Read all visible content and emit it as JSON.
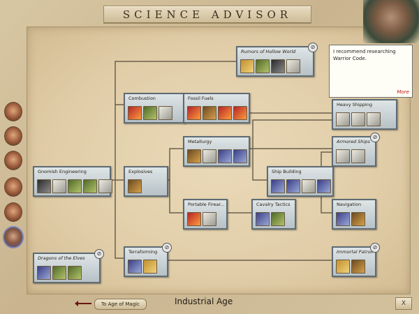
{
  "window": {
    "title": "SCIENCE ADVISOR"
  },
  "advisor": {
    "speech": "I recommend researching Warrior Code.",
    "more_link": "More"
  },
  "footer": {
    "back_button": "To Age of Magic",
    "age_label": "Industrial Age",
    "close_button": "X"
  },
  "techs": [
    {
      "id": "rumors",
      "label": "Rumors of Hollow World",
      "italic": true,
      "locked": true
    },
    {
      "id": "combustion",
      "label": "Combustion",
      "italic": false,
      "locked": false
    },
    {
      "id": "fossil",
      "label": "Fossil Fuels",
      "italic": false,
      "locked": false
    },
    {
      "id": "heavy",
      "label": "Heavy Shipping",
      "italic": false,
      "locked": false
    },
    {
      "id": "metallurgy",
      "label": "Metallurgy",
      "italic": false,
      "locked": false
    },
    {
      "id": "armored",
      "label": "Armored Ships",
      "italic": true,
      "locked": true
    },
    {
      "id": "gnomish",
      "label": "Gnomish Engineering",
      "italic": false,
      "locked": false
    },
    {
      "id": "explosives",
      "label": "Explosives",
      "italic": false,
      "locked": false
    },
    {
      "id": "shipbuilding",
      "label": "Ship Building",
      "italic": false,
      "locked": false
    },
    {
      "id": "firearms",
      "label": "Portable Firear...",
      "italic": false,
      "locked": false
    },
    {
      "id": "cavalry",
      "label": "Cavalry Tactics",
      "italic": false,
      "locked": false
    },
    {
      "id": "navigation",
      "label": "Navigation",
      "italic": false,
      "locked": false
    },
    {
      "id": "dragons",
      "label": "Dragons of the Elves",
      "italic": true,
      "locked": true
    },
    {
      "id": "terraforming",
      "label": "Terraforming",
      "italic": false,
      "locked": true
    },
    {
      "id": "immortal",
      "label": "Immortal Patron",
      "italic": true,
      "locked": true
    }
  ]
}
